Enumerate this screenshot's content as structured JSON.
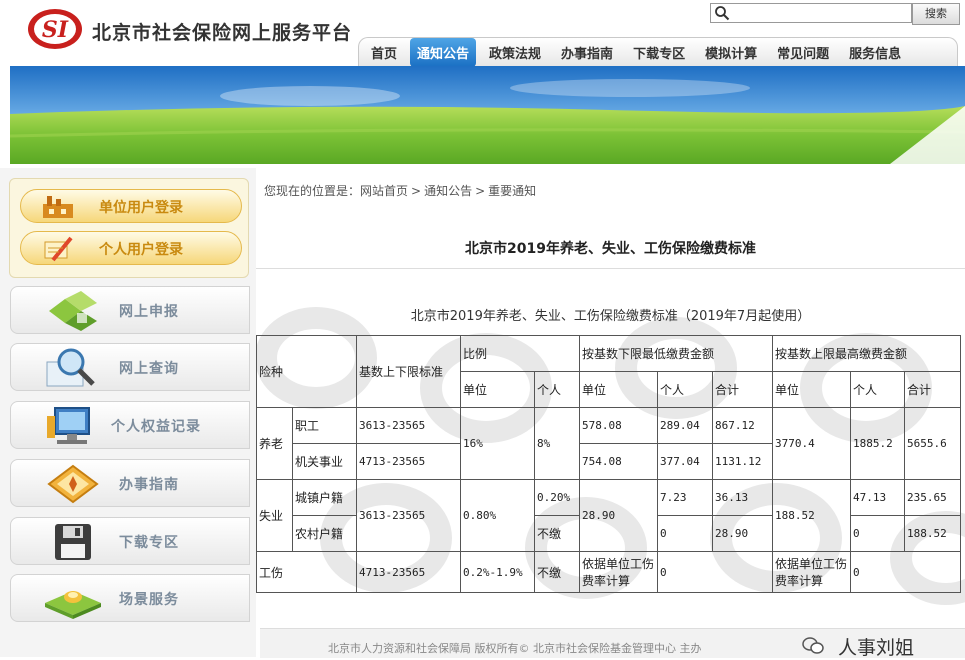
{
  "header": {
    "site_title": "北京市社会保险网上服务平台",
    "logo_letters": "SI",
    "search_button": "搜索"
  },
  "nav": [
    "首页",
    "通知公告",
    "政策法规",
    "办事指南",
    "下载专区",
    "模拟计算",
    "常见问题",
    "服务信息"
  ],
  "nav_active": "通知公告",
  "login": {
    "unit_login": "单位用户登录",
    "personal_login": "个人用户登录"
  },
  "sidebar": [
    {
      "label": "网上申报",
      "icon": "puzzle-icon"
    },
    {
      "label": "网上查询",
      "icon": "magnifier-icon"
    },
    {
      "label": "个人权益记录",
      "icon": "computer-icon"
    },
    {
      "label": "办事指南",
      "icon": "compass-icon"
    },
    {
      "label": "下载专区",
      "icon": "floppy-disk-icon"
    },
    {
      "label": "场景服务",
      "icon": "tray-icon"
    }
  ],
  "breadcrumb": {
    "prefix": "您现在的位置是：",
    "items": [
      "网站首页",
      "通知公告",
      "重要通知"
    ],
    "separator": ">"
  },
  "article": {
    "title": "北京市2019年养老、失业、工伤保险缴费标准",
    "subtitle": "北京市2019年养老、失业、工伤保险缴费标准（2019年7月起使用）"
  },
  "table": {
    "headers": {
      "type": "险种",
      "base_range": "基数上下限标准",
      "ratio": "比例",
      "min_amount": "按基数下限最低缴费金额",
      "max_amount": "按基数上限最高缴费金额",
      "unit": "单位",
      "individual": "个人",
      "total": "合计"
    },
    "pension": {
      "label": "养老",
      "ratio_unit": "16%",
      "ratio_individual": "8%",
      "max_unit": "3770.4",
      "max_individual": "1885.2",
      "max_total": "5655.6",
      "rows": [
        {
          "sub": "职工",
          "range": "3613-23565",
          "min_unit": "578.08",
          "min_individual": "289.04",
          "min_total": "867.12"
        },
        {
          "sub": "机关事业",
          "range": "4713-23565",
          "min_unit": "754.08",
          "min_individual": "377.04",
          "min_total": "1131.12"
        }
      ]
    },
    "unemployment": {
      "label": "失业",
      "range": "3613-23565",
      "ratio_unit": "0.80%",
      "min_unit": "28.90",
      "max_unit": "188.52",
      "rows": [
        {
          "sub": "城镇户籍",
          "ratio_individual": "0.20%",
          "min_individual": "7.23",
          "min_total": "36.13",
          "max_individual": "47.13",
          "max_total": "235.65"
        },
        {
          "sub": "农村户籍",
          "ratio_individual": "不缴",
          "min_individual": "0",
          "min_total": "28.90",
          "max_individual": "0",
          "max_total": "188.52"
        }
      ]
    },
    "injury": {
      "label": "工伤",
      "range": "4713-23565",
      "ratio_unit": "0.2%-1.9%",
      "ratio_individual": "不缴",
      "min_unit": "依据单位工伤费率计算",
      "min_individual": "0",
      "max_unit": "依据单位工伤费率计算",
      "max_individual": "0"
    }
  },
  "footer": {
    "text": "北京市人力资源和社会保障局 版权所有© 北京市社会保险基金管理中心 主办",
    "watermark": "人事刘姐"
  },
  "colors": {
    "nav_active": "#2b86d6",
    "login_text": "#c98a10",
    "sidebar_text": "#7c8c9c",
    "logo_red": "#c8201d"
  }
}
